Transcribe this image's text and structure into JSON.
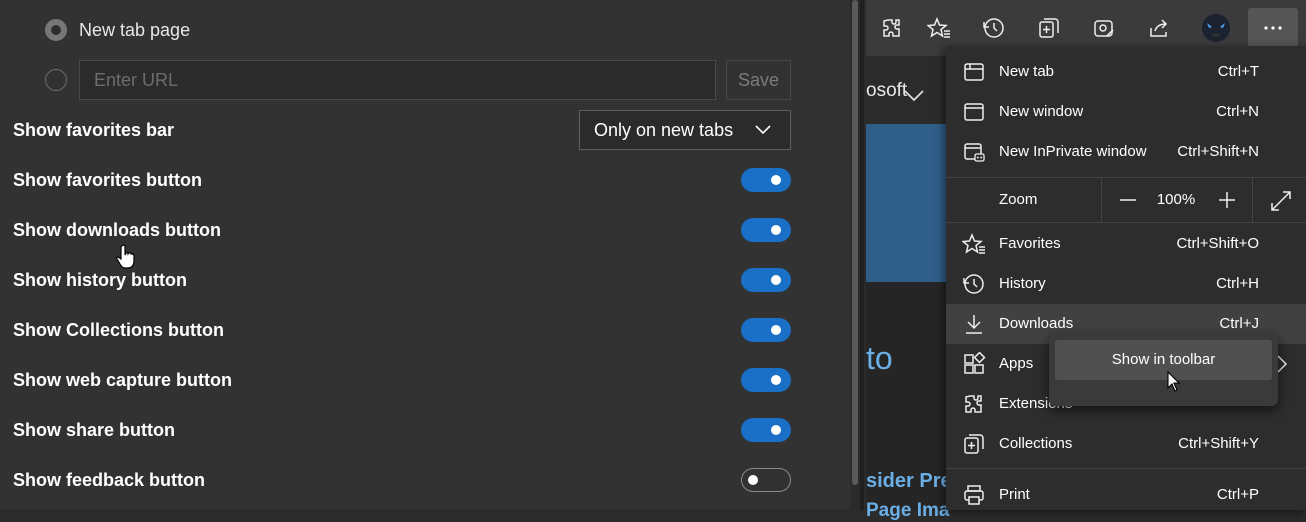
{
  "settings": {
    "startup": {
      "new_tab_label": "New tab page",
      "url_placeholder": "Enter URL",
      "save_label": "Save"
    },
    "favorites_bar": {
      "label": "Show favorites bar",
      "selected": "Only on new tabs"
    },
    "toggles": [
      {
        "label": "Show favorites button",
        "on": true
      },
      {
        "label": "Show downloads button",
        "on": true
      },
      {
        "label": "Show history button",
        "on": true
      },
      {
        "label": "Show Collections button",
        "on": true
      },
      {
        "label": "Show web capture button",
        "on": true
      },
      {
        "label": "Show share button",
        "on": true
      },
      {
        "label": "Show feedback button",
        "on": false
      }
    ]
  },
  "webpage": {
    "fragment1": "osoft",
    "fragment2": "to",
    "fragment3": "sider Prev",
    "fragment4": "Page Ima"
  },
  "menu": {
    "items": [
      {
        "label": "New tab",
        "shortcut": "Ctrl+T",
        "icon": "new-tab-icon"
      },
      {
        "label": "New window",
        "shortcut": "Ctrl+N",
        "icon": "new-window-icon"
      },
      {
        "label": "New InPrivate window",
        "shortcut": "Ctrl+Shift+N",
        "icon": "inprivate-icon"
      },
      {
        "label": "Favorites",
        "shortcut": "Ctrl+Shift+O",
        "icon": "favorites-icon"
      },
      {
        "label": "History",
        "shortcut": "Ctrl+H",
        "icon": "history-icon"
      },
      {
        "label": "Downloads",
        "shortcut": "Ctrl+J",
        "icon": "downloads-icon"
      },
      {
        "label": "Apps",
        "shortcut": "",
        "icon": "apps-icon"
      },
      {
        "label": "Extensions",
        "shortcut": "",
        "icon": "extensions-icon"
      },
      {
        "label": "Collections",
        "shortcut": "Ctrl+Shift+Y",
        "icon": "collections-icon"
      },
      {
        "label": "Print",
        "shortcut": "Ctrl+P",
        "icon": "print-icon"
      }
    ],
    "zoom": {
      "label": "Zoom",
      "value": "100%",
      "minus": "—",
      "plus": "+"
    }
  },
  "popup": {
    "label": "Show in toolbar"
  },
  "colors": {
    "accent": "#1a6fc6",
    "panel": "#323232",
    "menu": "#2d2d2d"
  }
}
